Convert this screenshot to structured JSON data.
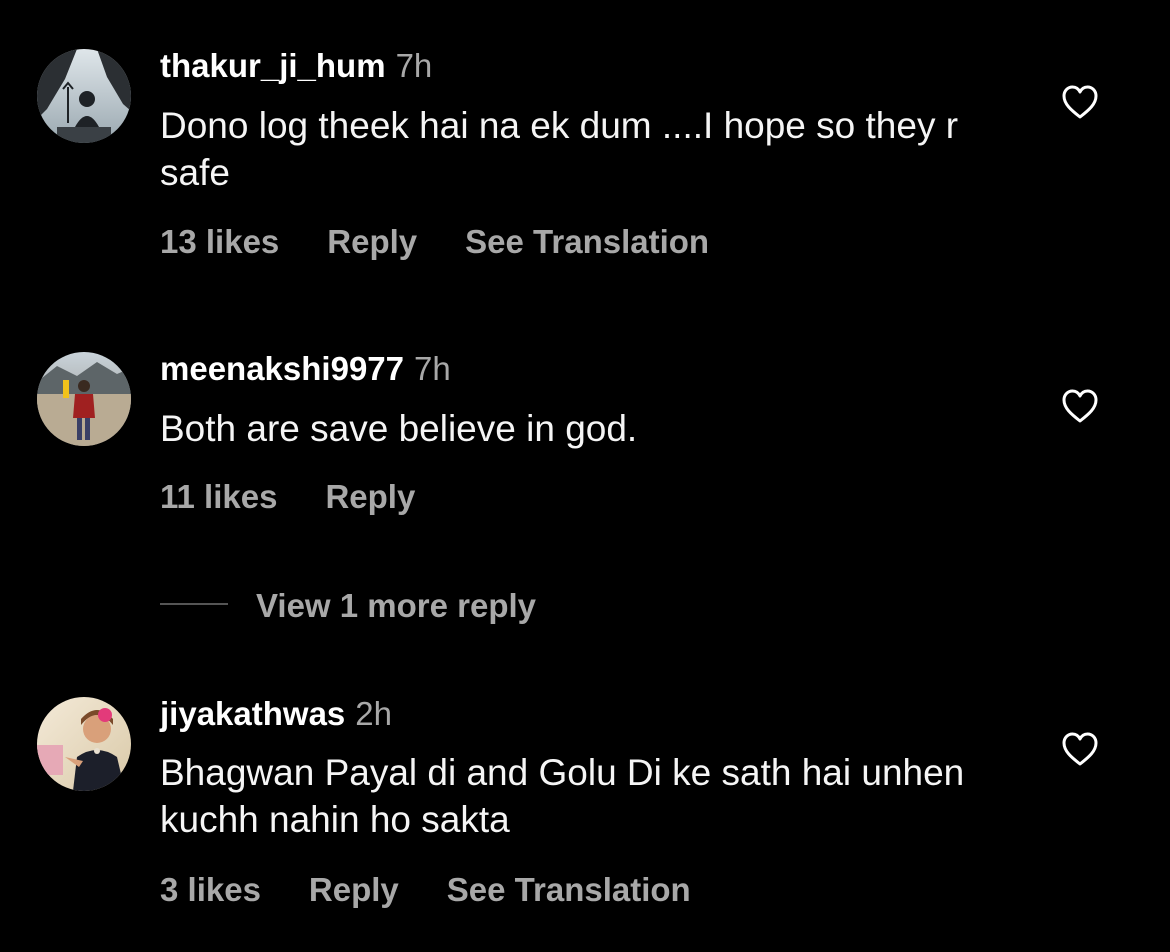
{
  "comments": [
    {
      "username": "thakur_ji_hum",
      "time": "7h",
      "text": "Dono log theek hai na ek dum ....I hope so they r safe",
      "likes": "13 likes",
      "reply": "Reply",
      "translate": "See Translation",
      "icon": "heart-outline-icon"
    },
    {
      "username": "meenakshi9977",
      "time": "7h",
      "text": "Both are save believe in god.",
      "likes": "11 likes",
      "reply": "Reply",
      "icon": "heart-outline-icon"
    },
    {
      "username": "jiyakathwas",
      "time": "2h",
      "text": "Bhagwan Payal di and Golu Di ke sath hai unhen kuchh nahin ho sakta",
      "likes": "3 likes",
      "reply": "Reply",
      "translate": "See Translation",
      "icon": "heart-outline-icon"
    }
  ],
  "view_more_replies": "View 1 more reply",
  "colors": {
    "background": "#000000",
    "primary_text": "#ffffff",
    "secondary_text": "#a8a8a8"
  }
}
